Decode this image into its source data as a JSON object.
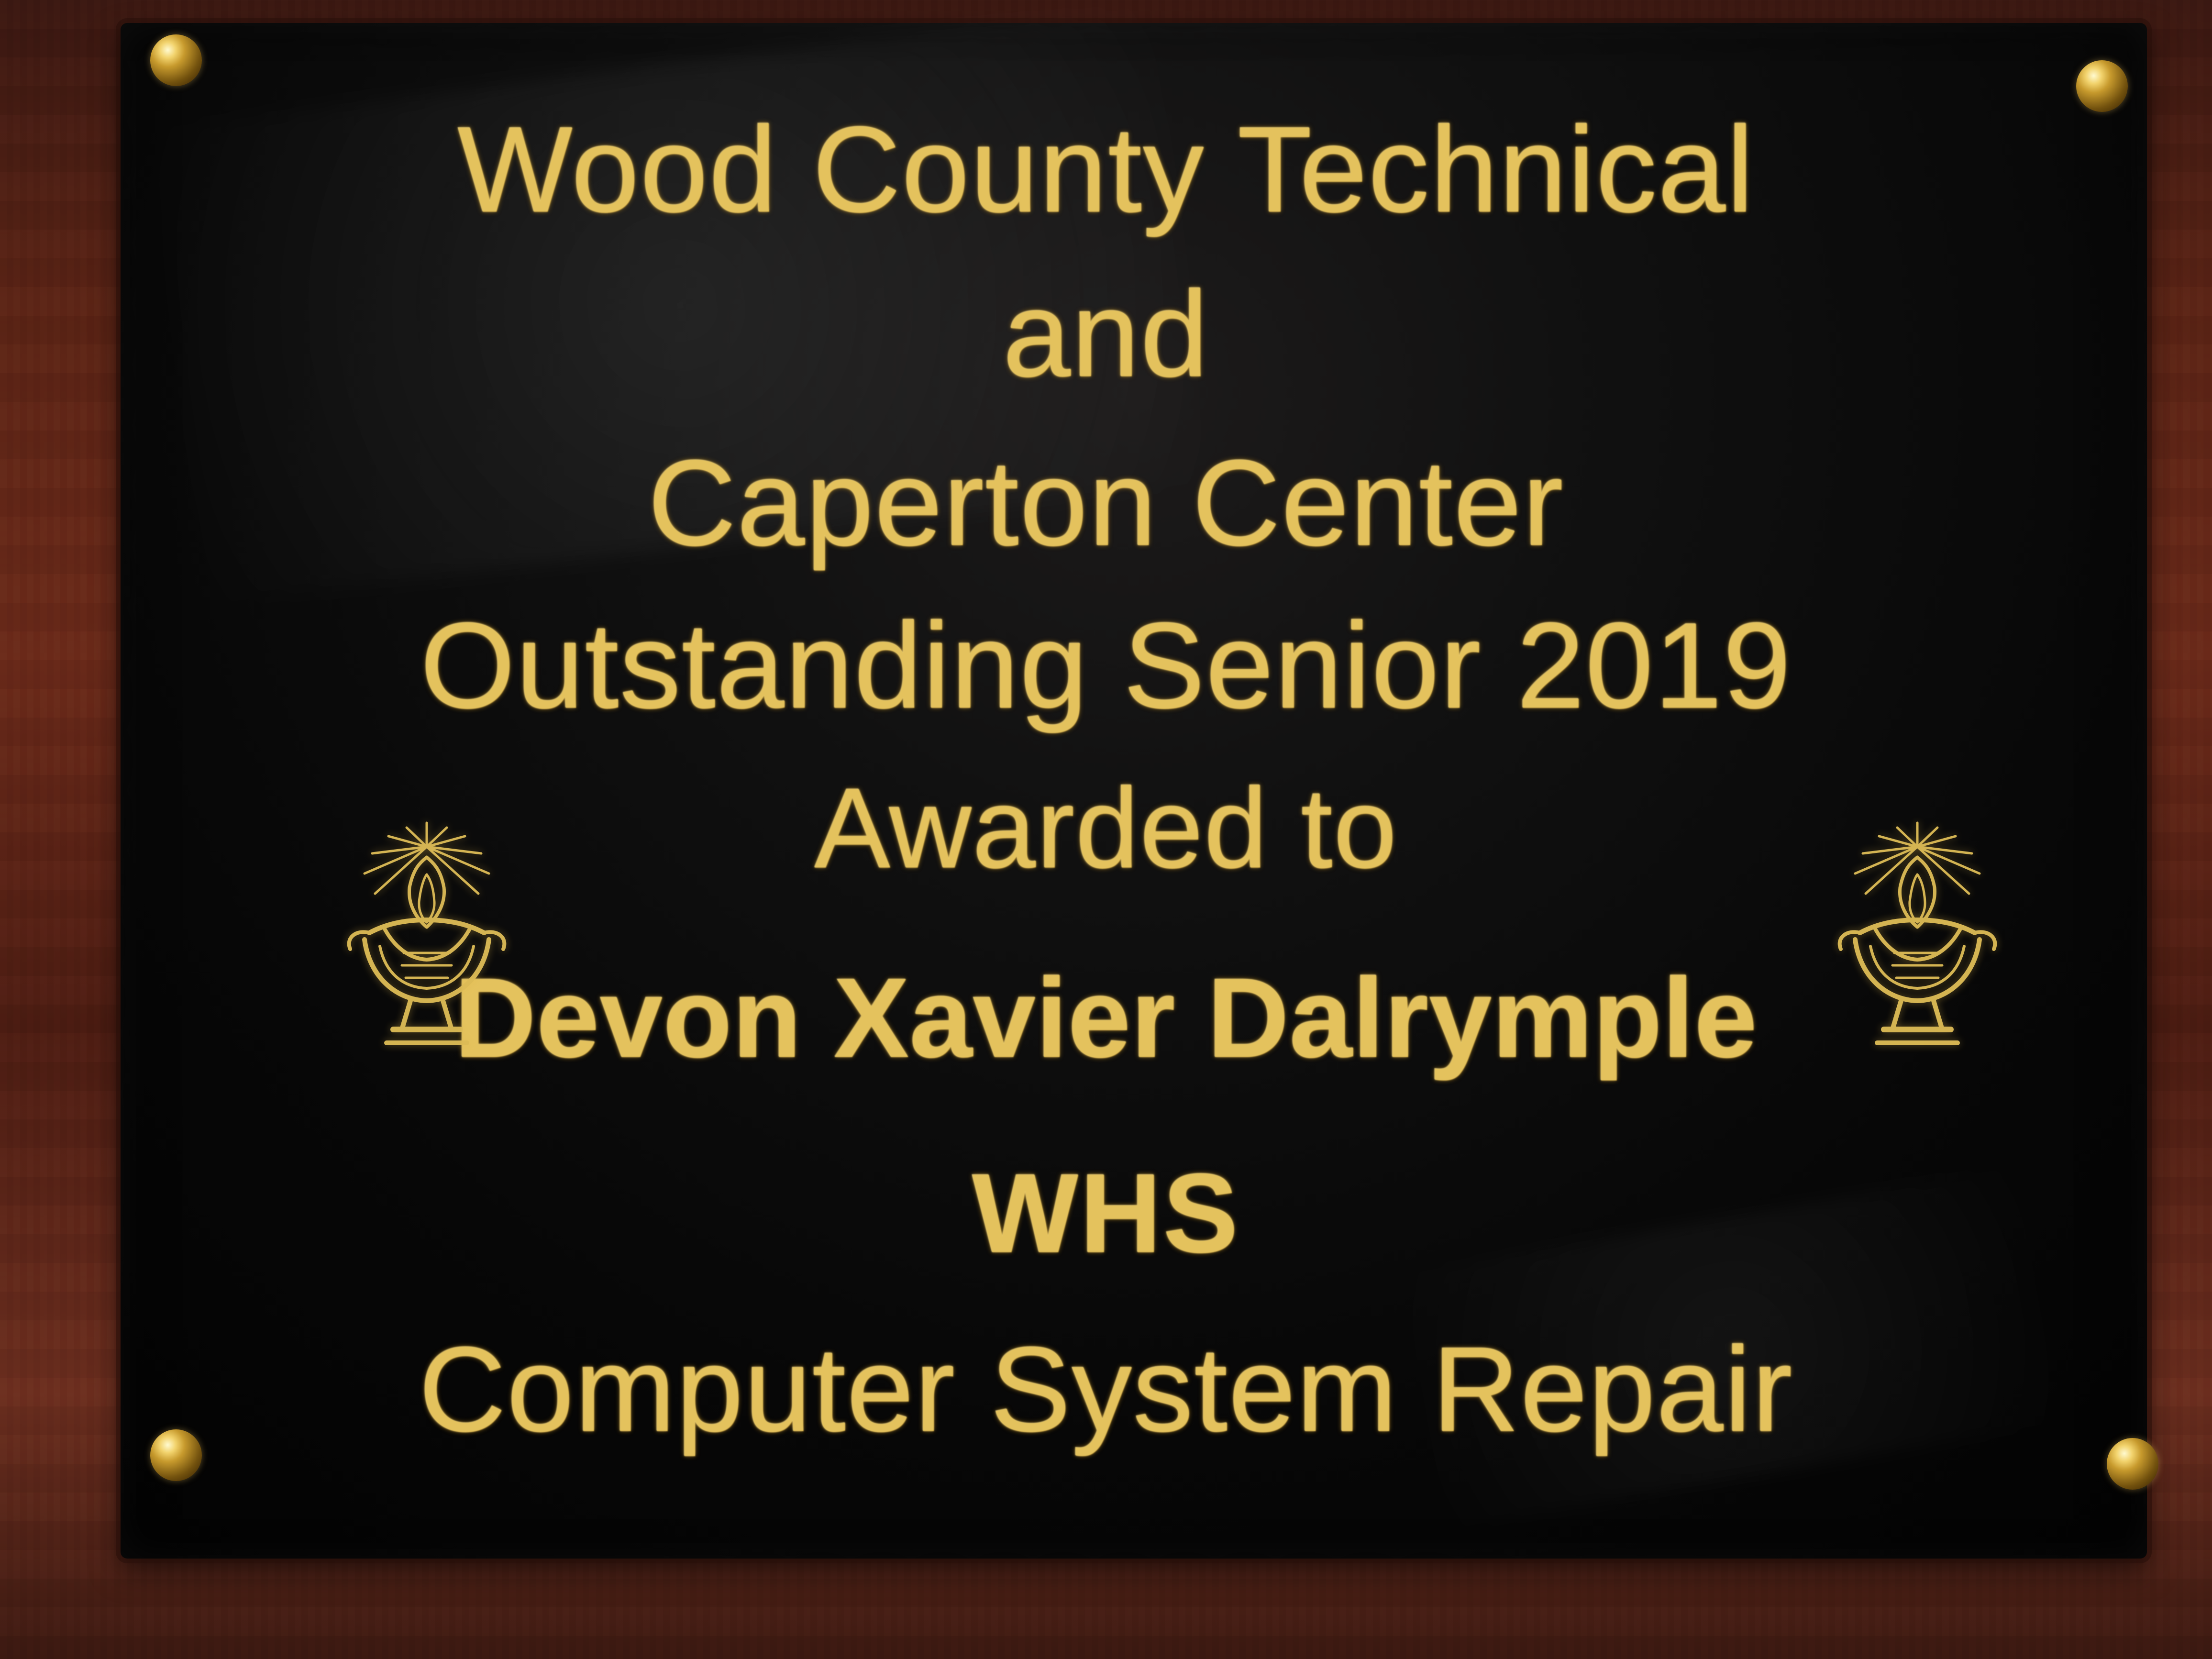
{
  "plaque": {
    "line1": "Wood County Technical",
    "line2": "and",
    "line3": "Caperton Center",
    "line4": "Outstanding Senior 2019",
    "line5": "Awarded to",
    "line6": "Devon Xavier Dalrymple",
    "line7": "WHS",
    "line8": "Computer System Repair"
  },
  "icons": {
    "left_ornament": "lamp-of-knowledge-icon",
    "right_ornament": "lamp-of-knowledge-icon",
    "screws": "brass-screw-icon"
  },
  "colors": {
    "plaque_background": "#050505",
    "engraving_gold": "#e4c25d",
    "wood_background": "#5b2416"
  }
}
